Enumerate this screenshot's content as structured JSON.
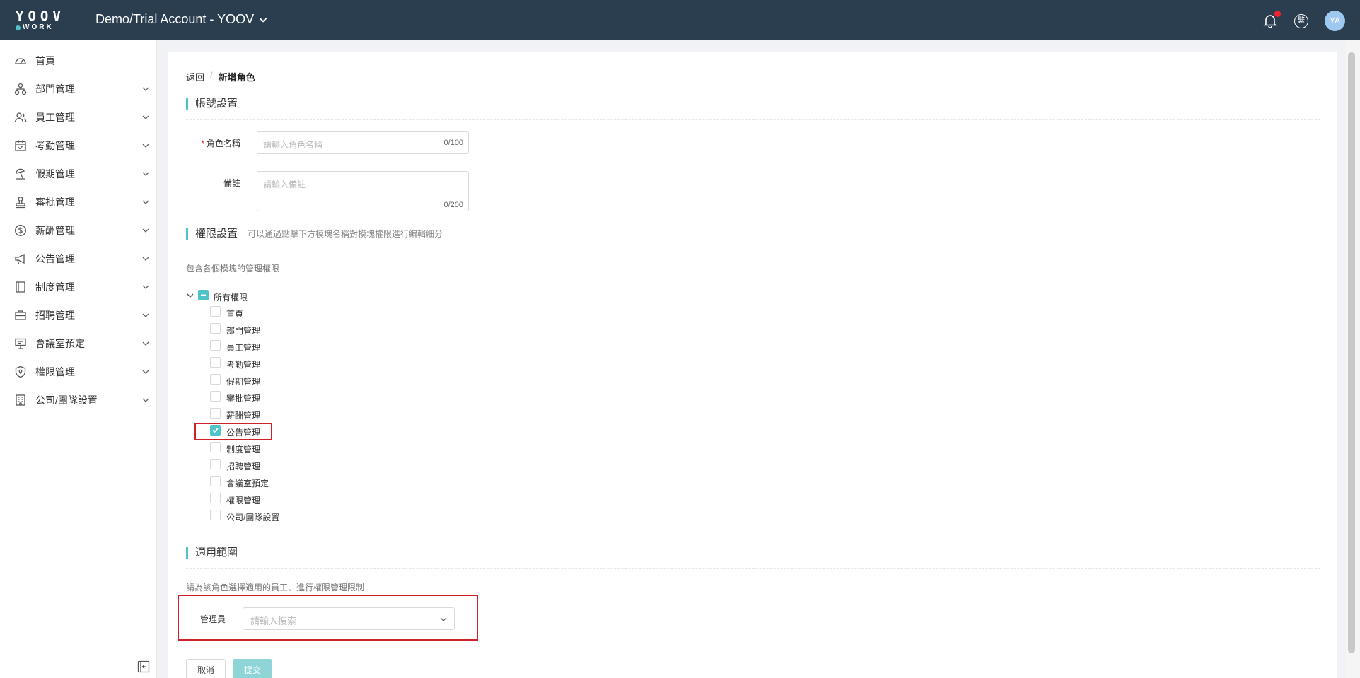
{
  "header": {
    "logo_top": "YOOV",
    "logo_bottom": "WORK",
    "account_name": "Demo/Trial Account - YOOV",
    "lang_label": "繁",
    "avatar_initials": "YA"
  },
  "sidebar": {
    "items": [
      {
        "label": "首頁",
        "icon": "dashboard-icon"
      },
      {
        "label": "部門管理",
        "icon": "org-chart-icon"
      },
      {
        "label": "員工管理",
        "icon": "users-icon"
      },
      {
        "label": "考勤管理",
        "icon": "calendar-check-icon"
      },
      {
        "label": "假期管理",
        "icon": "beach-icon"
      },
      {
        "label": "審批管理",
        "icon": "stamp-icon"
      },
      {
        "label": "薪酬管理",
        "icon": "dollar-icon"
      },
      {
        "label": "公告管理",
        "icon": "megaphone-icon"
      },
      {
        "label": "制度管理",
        "icon": "book-icon"
      },
      {
        "label": "招聘管理",
        "icon": "briefcase-icon"
      },
      {
        "label": "會議室預定",
        "icon": "presentation-icon"
      },
      {
        "label": "權限管理",
        "icon": "shield-icon"
      },
      {
        "label": "公司/團隊設置",
        "icon": "building-icon"
      }
    ]
  },
  "breadcrumb": {
    "back": "返回",
    "separator": "/",
    "current": "新增角色"
  },
  "account_section": {
    "title": "帳號設置",
    "role_name_label": "角色名稱",
    "role_name_placeholder": "請輸入角色名稱",
    "role_name_count": "0/100",
    "remark_label": "備註",
    "remark_placeholder": "請輸入備註",
    "remark_count": "0/200"
  },
  "permission_section": {
    "title": "權限設置",
    "hint": "可以通過點擊下方模塊名稱對模塊權限進行編輯細分",
    "description": "包含各個模塊的管理權限",
    "root_label": "所有權限",
    "root_state": "indeterminate",
    "modules": [
      {
        "label": "首頁",
        "checked": false
      },
      {
        "label": "部門管理",
        "checked": false
      },
      {
        "label": "員工管理",
        "checked": false
      },
      {
        "label": "考勤管理",
        "checked": false
      },
      {
        "label": "假期管理",
        "checked": false
      },
      {
        "label": "審批管理",
        "checked": false
      },
      {
        "label": "薪酬管理",
        "checked": false
      },
      {
        "label": "公告管理",
        "checked": true
      },
      {
        "label": "制度管理",
        "checked": false
      },
      {
        "label": "招聘管理",
        "checked": false
      },
      {
        "label": "會議室預定",
        "checked": false
      },
      {
        "label": "權限管理",
        "checked": false
      },
      {
        "label": "公司/團隊設置",
        "checked": false
      }
    ]
  },
  "scope_section": {
    "title": "適用範圍",
    "description": "請為該角色選擇適用的員工、進行權限管理限制",
    "admin_label": "管理員",
    "admin_placeholder": "請輸入搜索"
  },
  "actions": {
    "cancel": "取消",
    "submit": "提交"
  },
  "colors": {
    "topbar": "#2b3e50",
    "accent": "#4fc3c7",
    "highlight": "#d0202a"
  }
}
